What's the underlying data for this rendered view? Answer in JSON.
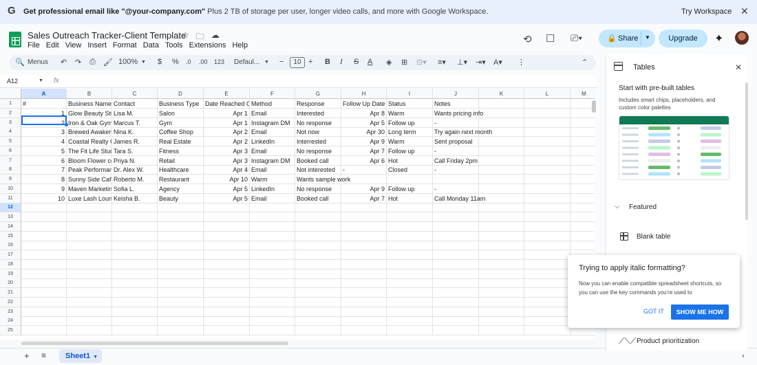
{
  "banner": {
    "bold": "Get professional email like \"@your-company.com\"",
    "rest": " Plus 2 TB of storage per user, longer video calls, and more with Google Workspace.",
    "try_label": "Try Workspace",
    "close_icon": "close-icon"
  },
  "document": {
    "title": "Sales Outreach Tracker-Client Template",
    "menus": [
      "File",
      "Edit",
      "View",
      "Insert",
      "Format",
      "Data",
      "Tools",
      "Extensions",
      "Help"
    ]
  },
  "header": {
    "share_label": "Share",
    "upgrade_label": "Upgrade"
  },
  "toolbar": {
    "menus_label": "Menus",
    "zoom": "100%",
    "currency": "$",
    "percent": "%",
    "decimal_decrease": ".0",
    "decimal_increase": ".00",
    "number_format": "123",
    "font": "Defaul...",
    "font_size": "10",
    "bold": "B",
    "italic": "I",
    "strike": "S",
    "text_color": "A"
  },
  "formula_bar": {
    "name_box": "A12",
    "fx": "fx"
  },
  "sheet": {
    "columns": [
      "A",
      "B",
      "C",
      "D",
      "E",
      "F",
      "G",
      "H",
      "I",
      "J",
      "K",
      "L",
      "M"
    ],
    "row_numbers": [
      "1",
      "2",
      "3",
      "4",
      "5",
      "6",
      "7",
      "8",
      "9",
      "10",
      "11",
      "12",
      "13",
      "14",
      "15",
      "16",
      "17",
      "18",
      "19",
      "20",
      "21",
      "22",
      "23",
      "24",
      "25"
    ],
    "header_row": [
      "#",
      "Business Name",
      "Contact",
      "Business Type",
      "Date Reached Out",
      "Method",
      "Response",
      "Follow Up Date",
      "Status",
      "Notes"
    ],
    "rows": [
      [
        "1",
        "Glow Beauty Studio",
        "Lisa M.",
        "Salon",
        "Apr 1",
        "Email",
        "Interested",
        "Apr 8",
        "Warm",
        "Wants pricing info"
      ],
      [
        "2",
        "Iron & Oak Gym",
        "Marcus T.",
        "Gym",
        "Apr 1",
        "Instagram DM",
        "No response",
        "Apr 5",
        "Follow up",
        "-"
      ],
      [
        "3",
        "Brewed Awakening",
        "Nina K.",
        "Coffee Shop",
        "Apr 2",
        "Email",
        "Not now",
        "Apr 30",
        "Long term",
        "Try again next month"
      ],
      [
        "4",
        "Coastal Realty Co.",
        "James R.",
        "Real Estate",
        "Apr 2",
        "LinkedIn",
        "Interrested",
        "Apr 9",
        "Warm",
        "Sent proposal"
      ],
      [
        "5",
        "The Fit Life Studio",
        "Tara S.",
        "Fitness",
        "Apr 3",
        "Email",
        "No response",
        "Apr 7",
        "Follow up",
        "-"
      ],
      [
        "6",
        "Bloom Flower co",
        "Priya N.",
        "Retail",
        "Apr 3",
        "Instagram DM",
        "Booked call",
        "Apr 6",
        "Hot",
        "Call Friday 2pm"
      ],
      [
        "7",
        "Peak Performance",
        "Dr. Alex W.",
        "Healthcare",
        "Apr 4",
        "Email",
        "Not interested",
        "-",
        "Closed",
        "-"
      ],
      [
        "8",
        "Sunny Side Cafe",
        "Roberto M.",
        "Restaurant",
        "Apr 10",
        "Warm",
        "Wants sample work",
        "",
        "",
        ""
      ],
      [
        "9",
        "Maven Marketing",
        "Sofia L.",
        "Agency",
        "Apr 5",
        "LinkedIn",
        "No response",
        "Apr 9",
        "Follow up",
        "-"
      ],
      [
        "10",
        "Luxe Lash Lounge",
        "Keisha B.",
        "Beauty",
        "Apr 5",
        "Email",
        "Booked call",
        "Apr 7",
        "Hot",
        "Call Monday 11am"
      ]
    ],
    "tab_name": "Sheet1"
  },
  "panel": {
    "title": "Tables",
    "prebuilt_title": "Start with pre-built tables",
    "prebuilt_desc": "Includes smart chips, placeholders, and custom color palettes",
    "featured": "Featured",
    "blank_table": "Blank table",
    "product_prioritization": "Product prioritization"
  },
  "popup": {
    "title": "Trying to apply italic formatting?",
    "body": "Now you can enable compatible spreadsheet shortcuts, so you can use the key commands you're used to",
    "got_it": "GOT IT",
    "show_me": "SHOW ME HOW"
  }
}
